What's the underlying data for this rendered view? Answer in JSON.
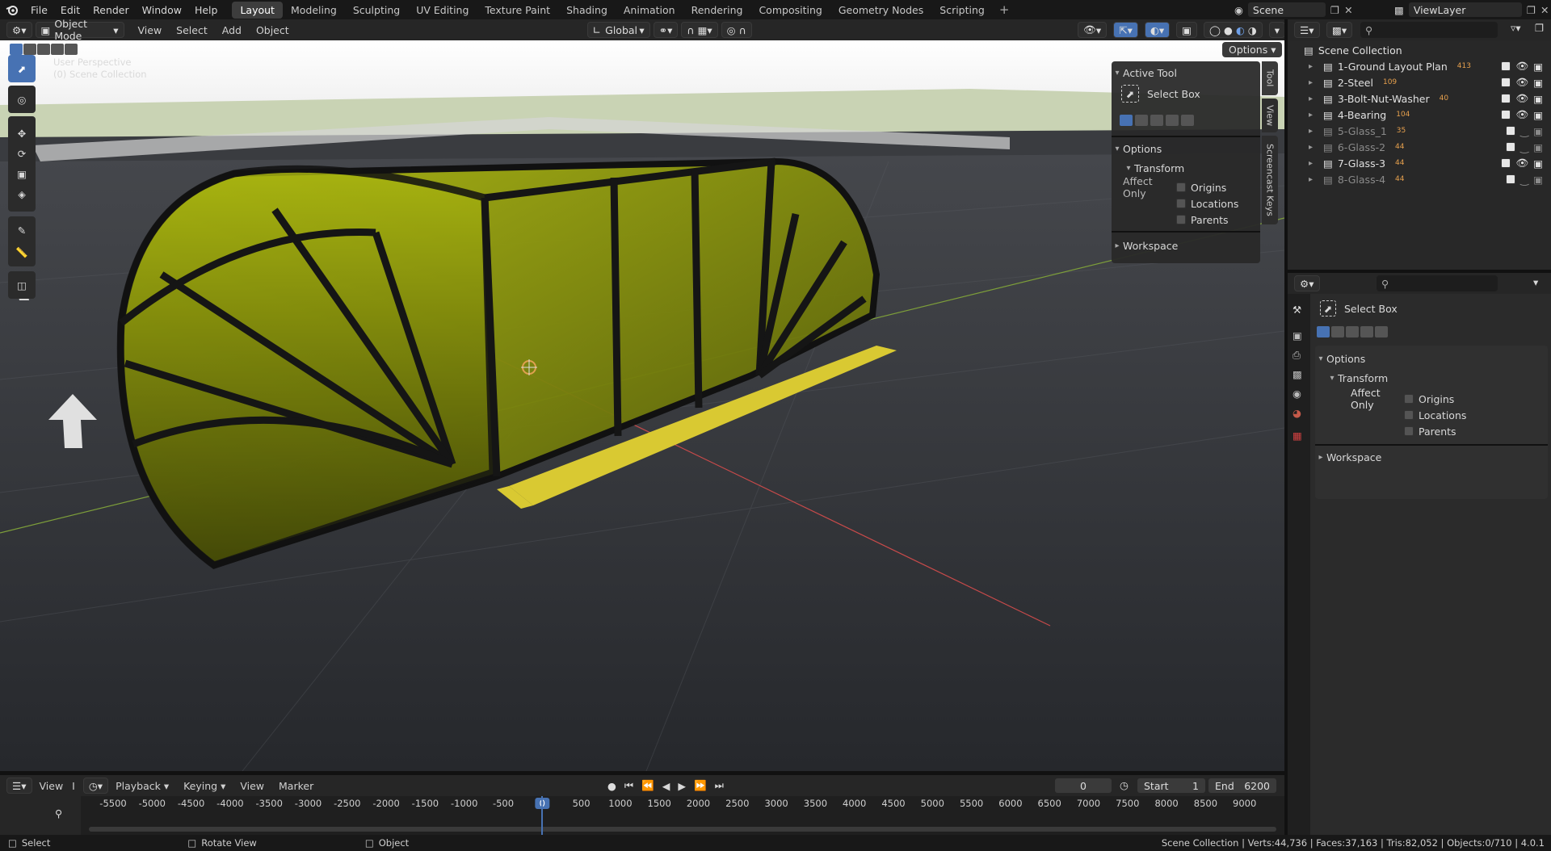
{
  "topbar": {
    "menu": [
      "File",
      "Edit",
      "Render",
      "Window",
      "Help"
    ],
    "workspaces": [
      "Layout",
      "Modeling",
      "Sculpting",
      "UV Editing",
      "Texture Paint",
      "Shading",
      "Animation",
      "Rendering",
      "Compositing",
      "Geometry Nodes",
      "Scripting"
    ],
    "active_workspace": "Layout",
    "add_workspace": "+",
    "scene": "Scene",
    "view_layer": "ViewLayer"
  },
  "viewport_header": {
    "mode": "Object Mode",
    "menus": [
      "View",
      "Select",
      "Add",
      "Object"
    ],
    "orientation": "Global",
    "options_button": "Options"
  },
  "viewport": {
    "perspective": "User Perspective",
    "collection": "(0) Scene Collection"
  },
  "sidebar": {
    "tabs": [
      "Tool",
      "View",
      "Screencast Keys"
    ],
    "active_tool_header": "Active Tool",
    "active_tool_name": "Select Box",
    "options_header": "Options",
    "transform_header": "Transform",
    "affect_only_label": "Affect Only",
    "affect_options": [
      "Origins",
      "Locations",
      "Parents"
    ],
    "workspace_header": "Workspace"
  },
  "outliner": {
    "root": "Scene Collection",
    "collections": [
      {
        "name": "1-Ground Layout Plan",
        "badge": "413",
        "dim": false
      },
      {
        "name": "2-Steel",
        "badge": "109",
        "dim": false
      },
      {
        "name": "3-Bolt-Nut-Washer",
        "badge": "40",
        "dim": false
      },
      {
        "name": "4-Bearing",
        "badge": "104",
        "dim": false
      },
      {
        "name": "5-Glass_1",
        "badge": "35",
        "dim": true
      },
      {
        "name": "6-Glass-2",
        "badge": "44",
        "dim": true
      },
      {
        "name": "7-Glass-3",
        "badge": "44",
        "dim": false
      },
      {
        "name": "8-Glass-4",
        "badge": "44",
        "dim": true
      }
    ]
  },
  "properties": {
    "tool_name": "Select Box",
    "options_header": "Options",
    "transform_header": "Transform",
    "affect_only_label": "Affect Only",
    "affect_options": [
      "Origins",
      "Locations",
      "Parents"
    ],
    "workspace_header": "Workspace"
  },
  "timeline": {
    "header_menus": [
      "View",
      "I"
    ],
    "playback": "Playback",
    "keying": "Keying",
    "view": "View",
    "marker": "Marker",
    "current_frame": "0",
    "start_label": "Start",
    "start_value": "1",
    "end_label": "End",
    "end_value": "6200",
    "ruler_ticks": [
      "-5500",
      "-5000",
      "-4500",
      "-4000",
      "-3500",
      "-3000",
      "-2500",
      "-2000",
      "-1500",
      "-1000",
      "-500",
      "0",
      "500",
      "1000",
      "1500",
      "2000",
      "2500",
      "3000",
      "3500",
      "4000",
      "4500",
      "5000",
      "5500",
      "6000",
      "6500",
      "7000",
      "7500",
      "8000",
      "8500",
      "9000"
    ]
  },
  "statusbar": {
    "left_select": "Select",
    "rotate_view": "Rotate View",
    "object": "Object",
    "stats": "Scene Collection | Verts:44,736 | Faces:37,163 | Tris:82,052 | Objects:0/710 | 4.0.1"
  }
}
